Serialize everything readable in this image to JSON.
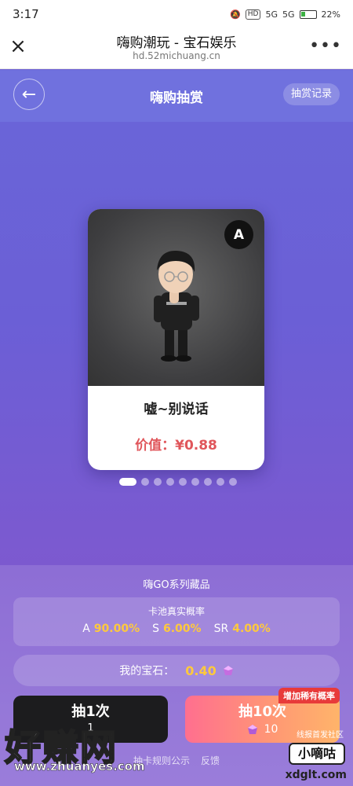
{
  "status": {
    "time": "3:17",
    "hd": "HD",
    "sig1": "5G",
    "sig2": "5G",
    "battery": "22%"
  },
  "browser": {
    "title": "嗨购潮玩 - 宝石娱乐",
    "url": "hd.52michuang.cn"
  },
  "header": {
    "title": "嗨购抽赏",
    "record_label": "抽赏记录"
  },
  "card": {
    "rank": "A",
    "name": "嘘~别说话",
    "price": "价值：¥0.88"
  },
  "pager": {
    "count": 9,
    "active": 0
  },
  "panel": {
    "series": "嗨GO系列藏品",
    "prob_title": "卡池真实概率",
    "probs": [
      {
        "grade": "A",
        "value": "90.00%"
      },
      {
        "grade": "S",
        "value": "6.00%"
      },
      {
        "grade": "SR",
        "value": "4.00%"
      }
    ],
    "gem_label": "我的宝石：",
    "gem_amount": "0.40"
  },
  "actions": {
    "draw1_label": "抽1次",
    "draw1_cost": "1",
    "draw10_label": "抽10次",
    "draw10_cost": "10",
    "rare_badge": "增加稀有概率"
  },
  "links": {
    "rules": "抽卡规则公示",
    "feedback": "反馈"
  },
  "watermark": {
    "left": "好赚网",
    "url": "www.zhuanyes.com",
    "right_top": "线报首发社区",
    "right": "小嘀咕",
    "bottom": "xdglt.com"
  },
  "colors": {
    "accent": "#ffc93c",
    "price": "#e0565b",
    "badge": "#e83a3a"
  }
}
